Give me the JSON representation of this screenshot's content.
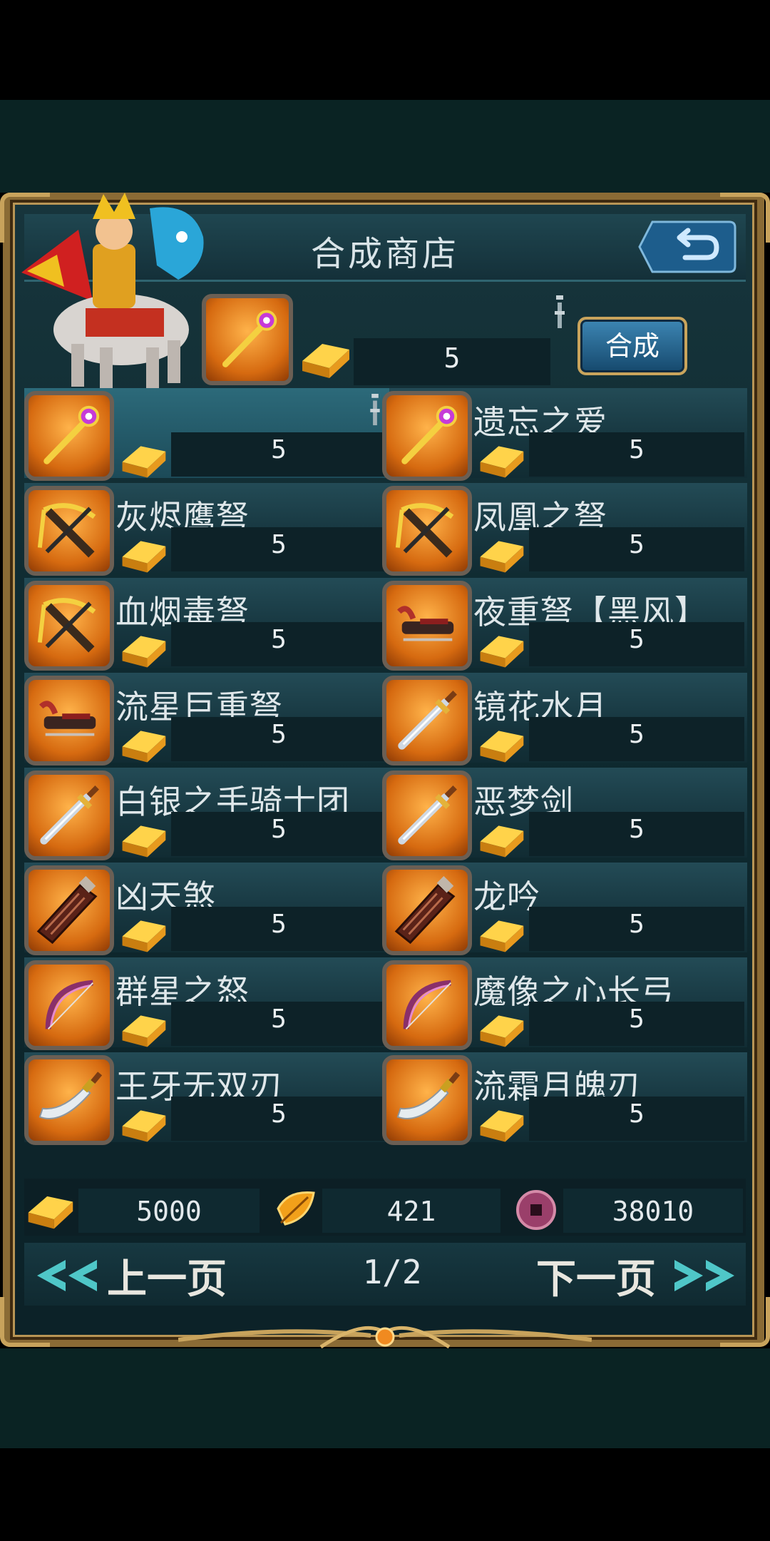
{
  "window": {
    "title": "合成商店"
  },
  "featured": {
    "cost": "5"
  },
  "actions": {
    "synthesize_label": "合成"
  },
  "items": [
    {
      "name": "",
      "cost": "5",
      "icon": "staff-icon",
      "selected": true
    },
    {
      "name": "遗忘之爱",
      "cost": "5",
      "icon": "staff-icon"
    },
    {
      "name": "灰烬鹰弩",
      "cost": "5",
      "icon": "crossbow-icon"
    },
    {
      "name": "凤凰之弩",
      "cost": "5",
      "icon": "crossbow-icon"
    },
    {
      "name": "血烟毒弩",
      "cost": "5",
      "icon": "crossbow-icon"
    },
    {
      "name": "夜重弩【黑风】",
      "cost": "5",
      "icon": "heavy-crossbow-icon"
    },
    {
      "name": "流星巨重弩",
      "cost": "5",
      "icon": "heavy-crossbow-icon"
    },
    {
      "name": "镜花水月",
      "cost": "5",
      "icon": "sword-icon"
    },
    {
      "name": "白银之手骑士团",
      "cost": "5",
      "icon": "sword-icon"
    },
    {
      "name": "恶梦剑",
      "cost": "5",
      "icon": "sword-icon"
    },
    {
      "name": "凶天煞",
      "cost": "5",
      "icon": "greatsword-icon"
    },
    {
      "name": "龙吟",
      "cost": "5",
      "icon": "greatsword-icon"
    },
    {
      "name": "群星之怒",
      "cost": "5",
      "icon": "bow-icon"
    },
    {
      "name": "魔像之心长弓",
      "cost": "5",
      "icon": "bow-icon"
    },
    {
      "name": "王牙无双刃",
      "cost": "5",
      "icon": "curved-blade-icon"
    },
    {
      "name": "流霜月魄刃",
      "cost": "5",
      "icon": "curved-blade-icon"
    }
  ],
  "currency": {
    "gold": "5000",
    "leaf": "421",
    "coin": "38010"
  },
  "pager": {
    "prev_label": "上一页",
    "next_label": "下一页",
    "page": "1/2"
  },
  "colors": {
    "slot_orange": "#d66a10",
    "frame_gold": "#c8a35c",
    "button_blue": "#2e6f9c",
    "panel_teal": "#16353e"
  }
}
